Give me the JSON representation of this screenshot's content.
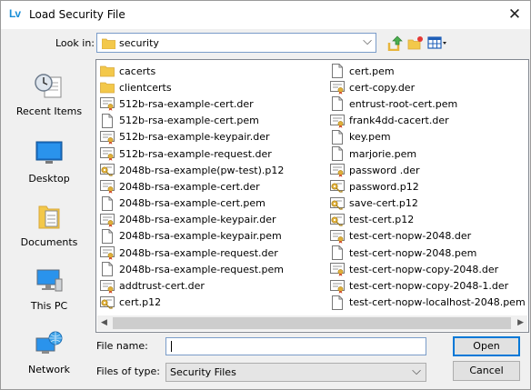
{
  "window": {
    "title": "Load Security File",
    "app_icon_text": "Lv",
    "close_glyph": "✕"
  },
  "lookin": {
    "label": "Look in:",
    "value": "security",
    "chevron": "⌵"
  },
  "places": [
    {
      "label": "Recent Items",
      "icon": "recent-items-icon"
    },
    {
      "label": "Desktop",
      "icon": "desktop-icon"
    },
    {
      "label": "Documents",
      "icon": "documents-icon"
    },
    {
      "label": "This PC",
      "icon": "this-pc-icon"
    },
    {
      "label": "Network",
      "icon": "network-icon"
    }
  ],
  "files_col1": [
    {
      "name": "cacerts",
      "type": "folder"
    },
    {
      "name": "clientcerts",
      "type": "folder"
    },
    {
      "name": "512b-rsa-example-cert.der",
      "type": "cert"
    },
    {
      "name": "512b-rsa-example-cert.pem",
      "type": "doc"
    },
    {
      "name": "512b-rsa-example-keypair.der",
      "type": "cert"
    },
    {
      "name": "512b-rsa-example-request.der",
      "type": "cert"
    },
    {
      "name": "2048b-rsa-example(pw-test).p12",
      "type": "p12"
    },
    {
      "name": "2048b-rsa-example-cert.der",
      "type": "cert"
    },
    {
      "name": "2048b-rsa-example-cert.pem",
      "type": "doc"
    },
    {
      "name": "2048b-rsa-example-keypair.der",
      "type": "cert"
    },
    {
      "name": "2048b-rsa-example-keypair.pem",
      "type": "doc"
    },
    {
      "name": "2048b-rsa-example-request.der",
      "type": "cert"
    },
    {
      "name": "2048b-rsa-example-request.pem",
      "type": "doc"
    },
    {
      "name": "addtrust-cert.der",
      "type": "cert"
    },
    {
      "name": "cert.p12",
      "type": "p12"
    }
  ],
  "files_col2": [
    {
      "name": "cert.pem",
      "type": "doc"
    },
    {
      "name": "cert-copy.der",
      "type": "cert"
    },
    {
      "name": "entrust-root-cert.pem",
      "type": "doc"
    },
    {
      "name": "frank4dd-cacert.der",
      "type": "cert"
    },
    {
      "name": "key.pem",
      "type": "doc"
    },
    {
      "name": "marjorie.pem",
      "type": "doc"
    },
    {
      "name": "password .der",
      "type": "cert"
    },
    {
      "name": "password.p12",
      "type": "p12"
    },
    {
      "name": "save-cert.p12",
      "type": "p12"
    },
    {
      "name": "test-cert.p12",
      "type": "p12"
    },
    {
      "name": "test-cert-nopw-2048.der",
      "type": "cert"
    },
    {
      "name": "test-cert-nopw-2048.pem",
      "type": "doc"
    },
    {
      "name": "test-cert-nopw-copy-2048.der",
      "type": "cert"
    },
    {
      "name": "test-cert-nopw-copy-2048-1.der",
      "type": "cert"
    },
    {
      "name": "test-cert-nopw-localhost-2048.pem",
      "type": "doc"
    }
  ],
  "filename": {
    "label": "File name:",
    "value": ""
  },
  "filetype": {
    "label": "Files of type:",
    "value": "Security Files",
    "chevron": "⌵"
  },
  "buttons": {
    "open": "Open",
    "cancel": "Cancel"
  },
  "scrollbar": {
    "left_arrow": "◀",
    "right_arrow": "▶"
  },
  "colors": {
    "accent": "#0078d7",
    "folder": "#f3c84a",
    "cert_ribbon": "#d14b2b"
  }
}
